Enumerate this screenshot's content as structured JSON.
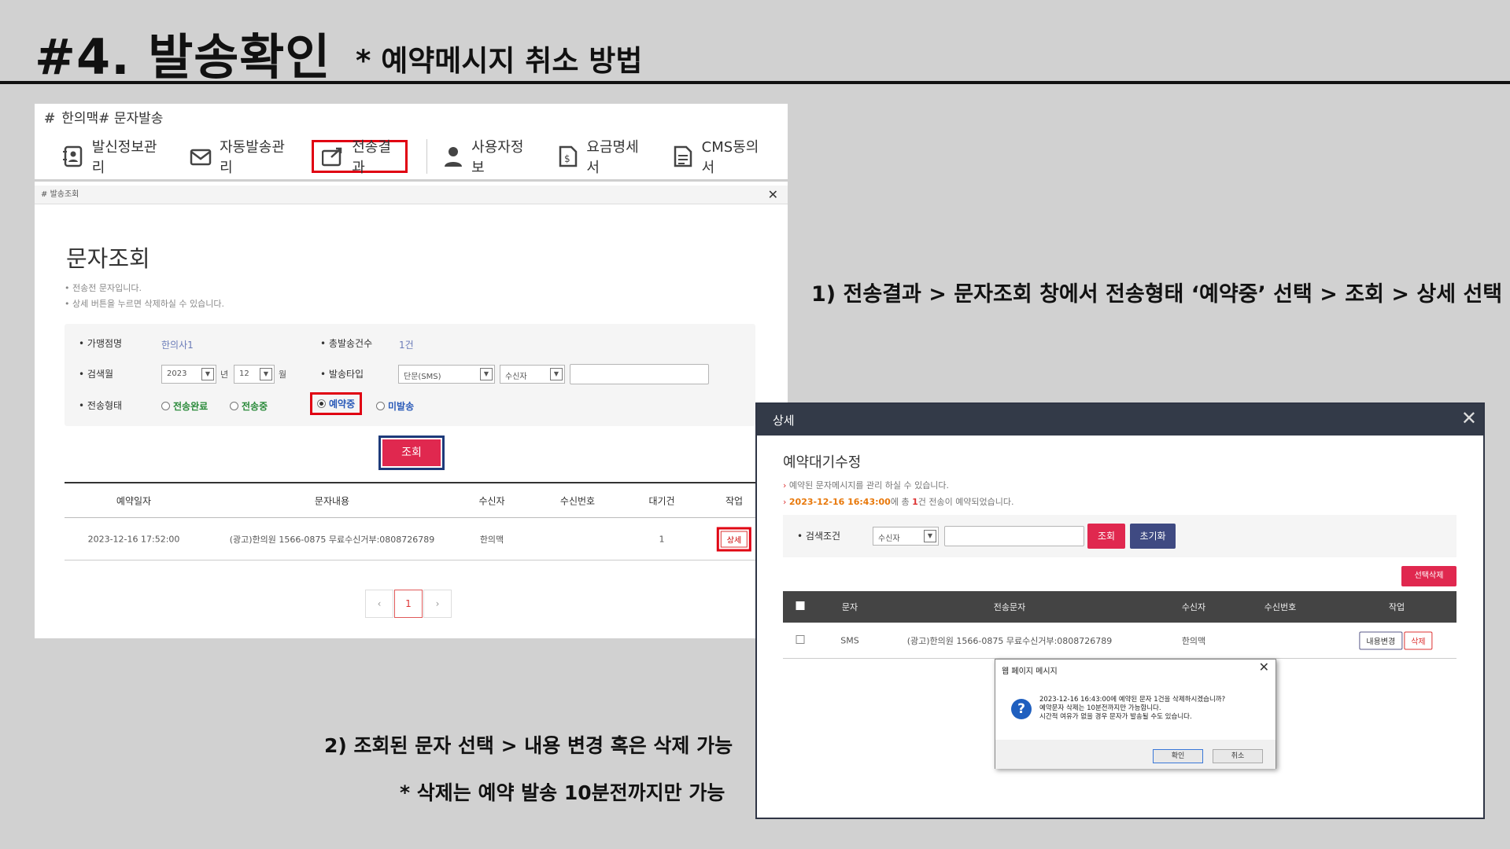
{
  "slide": {
    "title": "#4. 발송확인",
    "subtitle": "* 예약메시지 취소 방법",
    "step1": "1) 전송결과 > 문자조회 창에서 전송형태 ‘예약중’ 선택 > 조회 > 상세 선택",
    "step2": "2) 조회된 문자 선택 > 내용 변경 혹은 삭제 가능",
    "step2_note": "* 삭제는 예약 발송 10분전까지만 가능"
  },
  "app": {
    "hash": "#",
    "title": "한의맥# 문자발송",
    "menu": [
      {
        "label": "발신정보관리",
        "icon": "contact-book-icon"
      },
      {
        "label": "자동발송관리",
        "icon": "mail-check-icon"
      },
      {
        "label": "전송결과",
        "icon": "send-result-icon"
      },
      {
        "label": "사용자정보",
        "icon": "user-icon"
      },
      {
        "label": "요금명세서",
        "icon": "invoice-icon"
      },
      {
        "label": "CMS동의서",
        "icon": "document-icon"
      }
    ]
  },
  "query_dialog": {
    "bar_title": "발송조회",
    "heading": "문자조회",
    "notes": [
      "전송전 문자입니다.",
      "상세 버튼을 누르면 삭제하실 수 있습니다."
    ],
    "labels": {
      "branch": "가맹점명",
      "total": "총발송건수",
      "month": "검색월",
      "type": "발송타입",
      "status": "전송형태"
    },
    "branch_value": "한의사1",
    "total_value": "1건",
    "year": "2023",
    "year_unit": "년",
    "month": "12",
    "month_unit": "월",
    "msg_type": "단문(SMS)",
    "target": "수신자",
    "radios": [
      "전송완료",
      "전송중",
      "예약중",
      "미발송"
    ],
    "search_button": "조회",
    "columns": [
      "예약일자",
      "문자내용",
      "수신자",
      "수신번호",
      "대기건",
      "작업"
    ],
    "rows": [
      {
        "date": "2023-12-16 17:52:00",
        "content": "(광고)한의원 1566-0875 무료수신거부:0808726789",
        "recipient": "한의맥",
        "number": "",
        "waiting": "1",
        "action": "상세"
      }
    ],
    "pages": [
      "‹",
      "1",
      "›"
    ]
  },
  "detail": {
    "bar_title": "상세",
    "heading": "예약대기수정",
    "note1": "예약된 문자메시지를 관리 하실 수 있습니다.",
    "note2_date": "2023-12-16 16:43:00",
    "note2_a": "에 총 ",
    "note2_count": "1",
    "note2_b": "건 전송이 예약되었습니다.",
    "search_label": "검색조건",
    "search_select": "수신자",
    "search_button": "조회",
    "reset_button": "초기화",
    "delete_selected": "선택삭제",
    "columns": [
      "문자",
      "전송문자",
      "수신자",
      "수신번호",
      "작업"
    ],
    "rows": [
      {
        "type": "SMS",
        "content": "(광고)한의원 1566-0875 무료수신거부:0808726789",
        "recipient": "한의맥",
        "number": "",
        "edit": "내용변경",
        "delete": "삭제"
      }
    ]
  },
  "msgbox": {
    "title": "웹 페이지 메시지",
    "line1": "2023-12-16 16:43:00에 예약된 문자 1건을 삭제하시겠습니까?",
    "line2": "예약문자 삭제는 10분전까지만 가능합니다.",
    "line3": "시간적 여유가 없을 경우 문자가 발송될 수도 있습니다.",
    "ok": "확인",
    "cancel": "취소"
  },
  "colors": {
    "highlight": "#e00012",
    "accent": "#e0284f",
    "navy": "#333a48"
  }
}
